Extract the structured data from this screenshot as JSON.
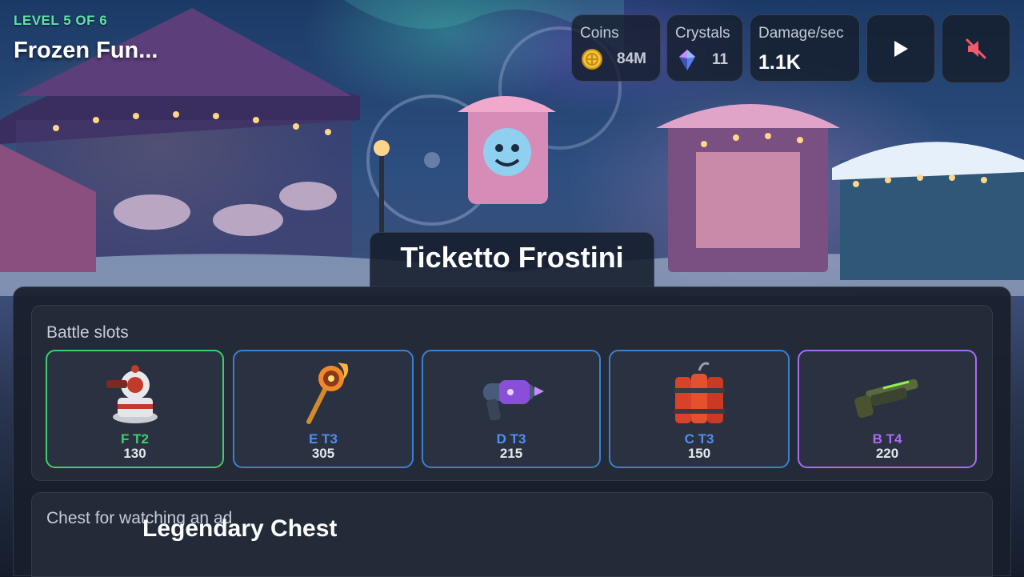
{
  "level": {
    "progress_label": "LEVEL 5 OF 6",
    "title": "Frozen Fun..."
  },
  "stats": {
    "coins": {
      "label": "Coins",
      "value": "84M",
      "icon": "coin-icon"
    },
    "crystals": {
      "label": "Crystals",
      "value": "11",
      "icon": "crystal-icon"
    },
    "damage": {
      "label": "Damage/sec",
      "value": "1.1K"
    }
  },
  "controls": {
    "play_icon": "play-icon",
    "sound_icon": "sound-muted-icon"
  },
  "boss": {
    "name": "Ticketto Frostini"
  },
  "battle_slots": {
    "title": "Battle slots",
    "slots": [
      {
        "tier": "F T2",
        "power": "130",
        "icon": "turret-icon",
        "color": "#3fce6d"
      },
      {
        "tier": "E T3",
        "power": "305",
        "icon": "fire-staff-icon",
        "color": "#4f8ff0"
      },
      {
        "tier": "D T3",
        "power": "215",
        "icon": "blaster-icon",
        "color": "#4f8ff0"
      },
      {
        "tier": "C T3",
        "power": "150",
        "icon": "dynamite-icon",
        "color": "#4f8ff0"
      },
      {
        "tier": "B T4",
        "power": "220",
        "icon": "shotgun-icon",
        "color": "#a86cf0"
      }
    ]
  },
  "ad_chest": {
    "title": "Chest for watching an ad",
    "chest_name": "Legendary Chest"
  }
}
